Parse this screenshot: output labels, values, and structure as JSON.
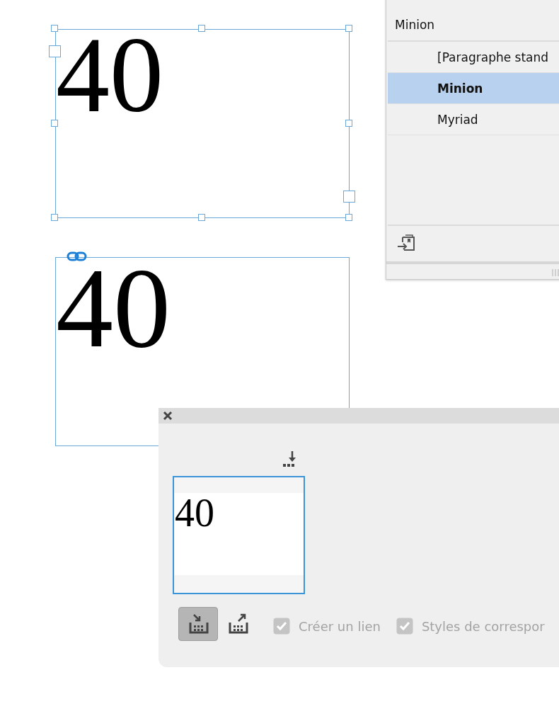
{
  "frames": [
    {
      "text": "40",
      "selected": true,
      "linked": false
    },
    {
      "text": "40",
      "selected": false,
      "linked": true
    }
  ],
  "styles_panel": {
    "current_style": "Minion",
    "styles": [
      {
        "label": "[Paragraphe stand",
        "selected": false
      },
      {
        "label": "Minion",
        "selected": true
      },
      {
        "label": "Myriad",
        "selected": false
      }
    ]
  },
  "content_panel": {
    "preview_text": "40",
    "modes": [
      {
        "kind": "place",
        "selected": true
      },
      {
        "kind": "pick",
        "selected": false
      }
    ],
    "options": [
      {
        "label": "Créer un lien",
        "checked": true,
        "disabled": true
      },
      {
        "label": "Styles de correspor",
        "checked": true,
        "disabled": true
      }
    ]
  }
}
